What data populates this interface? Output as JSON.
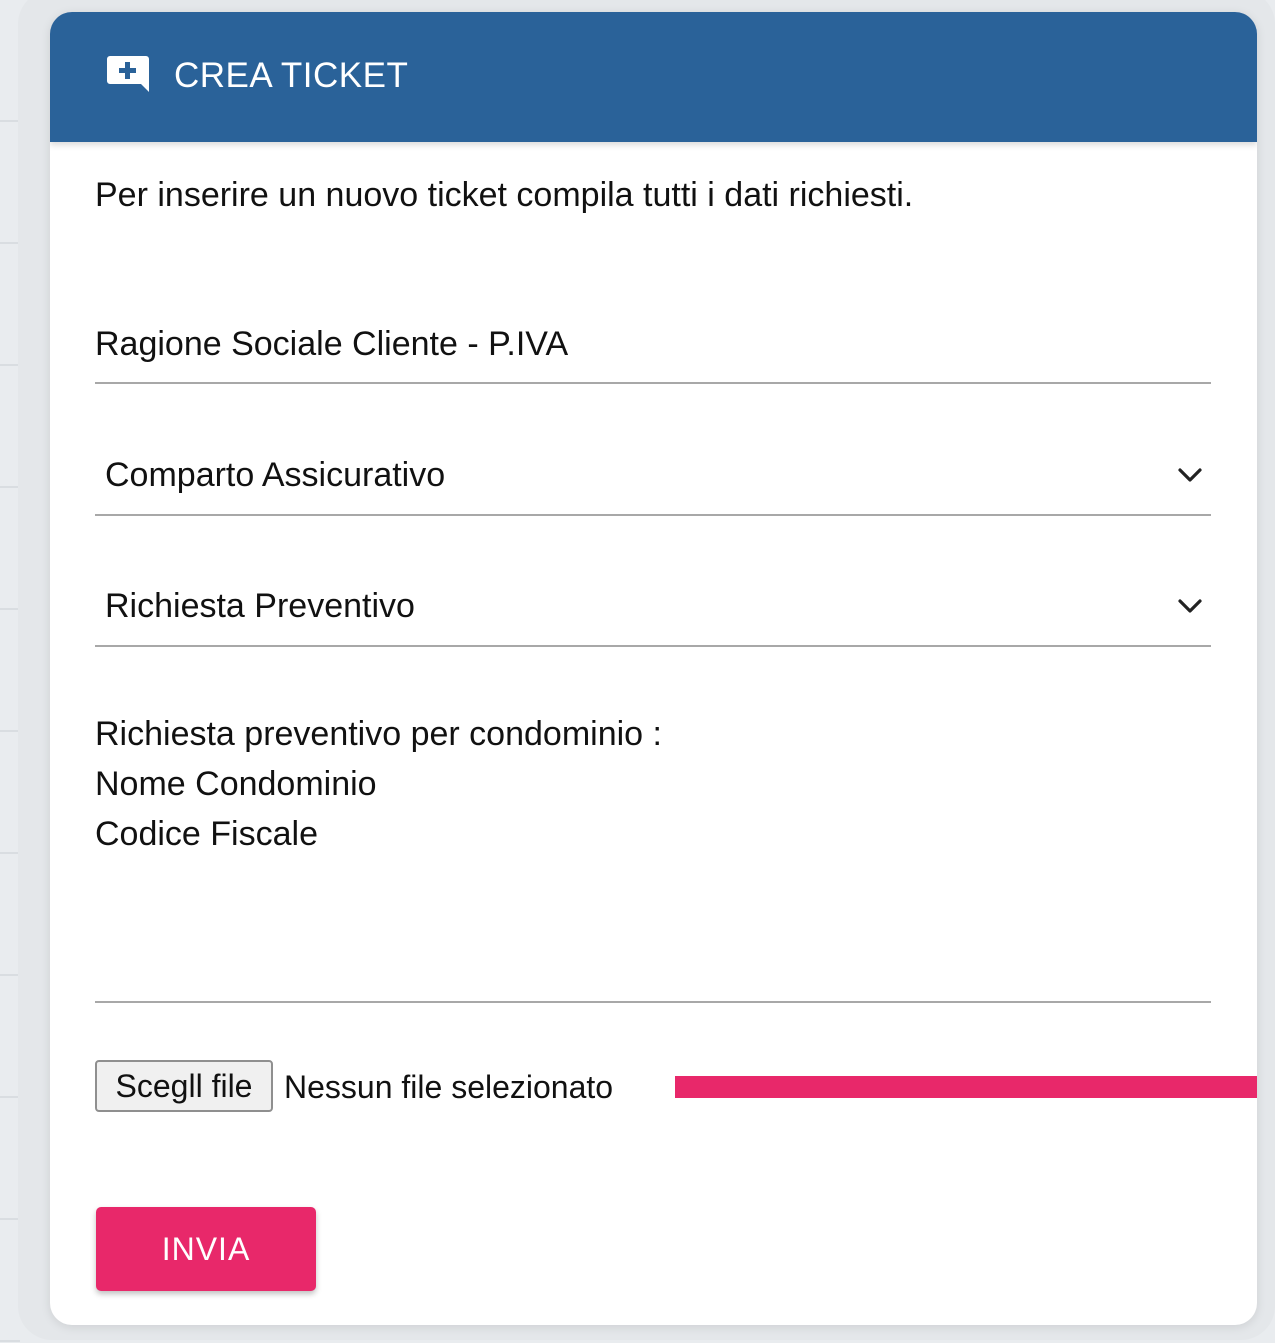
{
  "header": {
    "title": "CREA TICKET",
    "icon": "comment-plus-icon"
  },
  "intro": "Per inserire un nuovo ticket compila tutti i dati richiesti.",
  "form": {
    "client_field": {
      "value": "Ragione Sociale Cliente - P.IVA"
    },
    "sector_select": {
      "selected": "Comparto Assicurativo",
      "icon": "chevron-down-icon"
    },
    "request_select": {
      "selected": "Richiesta Preventivo",
      "icon": "chevron-down-icon"
    },
    "message": {
      "lines": [
        "Richiesta preventivo per condominio :",
        "Nome Condominio",
        "Codice Fiscale"
      ]
    },
    "file": {
      "button_label": "Scegll file",
      "status": "Nessun file selezionato"
    },
    "submit_label": "INVIA"
  },
  "colors": {
    "header_bg": "#2a6299",
    "accent": "#e8286a",
    "text": "#111111",
    "divider": "#a8a8a8"
  }
}
